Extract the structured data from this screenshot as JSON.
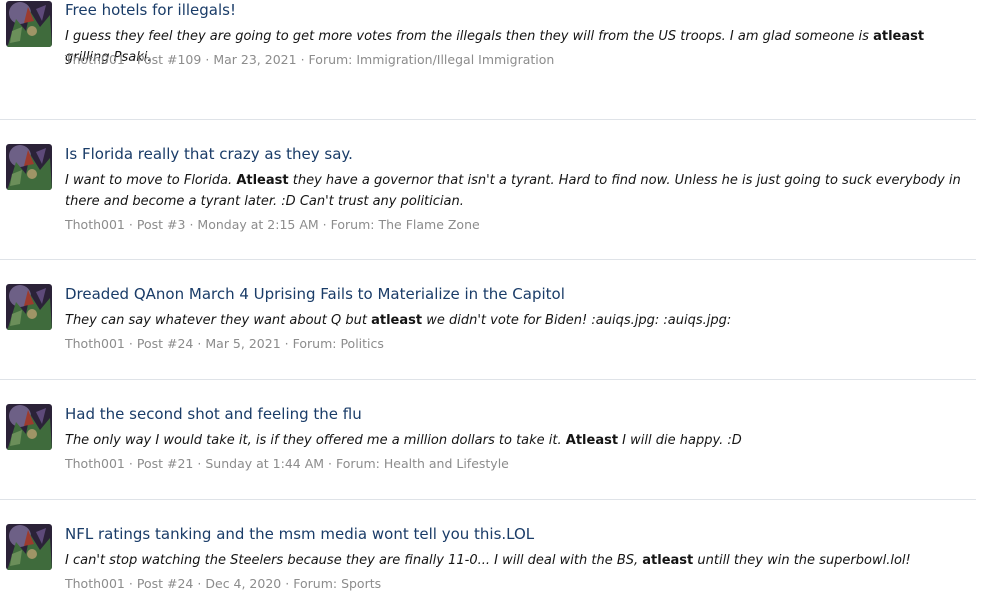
{
  "results": [
    {
      "title": "Free hotels for illegals!",
      "snippet_before": "I guess they feel they are going to get more votes from the illegals then they will from the US troops. I am glad someone is ",
      "highlight": "atleast",
      "snippet_after": " grilling Psaki.",
      "author": "Thoth001",
      "post": "Post #109",
      "date": "Mar 23, 2021",
      "forum_prefix": "Forum:",
      "forum": "Immigration/Illegal Immigration"
    },
    {
      "title": "Is Florida really that crazy as they say.",
      "snippet_before": "I want to move to Florida. ",
      "highlight": "Atleast",
      "snippet_after": " they have a governor that isn't a tyrant. Hard to find now. Unless he is just going to suck everybody in there and become a tyrant later. :D Can't trust any politician.",
      "author": "Thoth001",
      "post": "Post #3",
      "date": "Monday at 2:15 AM",
      "forum_prefix": "Forum:",
      "forum": "The Flame Zone"
    },
    {
      "title": "Dreaded QAnon March 4 Uprising Fails to Materialize in the Capitol",
      "snippet_before": "They can say whatever they want about Q but ",
      "highlight": "atleast",
      "snippet_after": " we didn't vote for Biden! :auiqs.jpg: :auiqs.jpg:",
      "author": "Thoth001",
      "post": "Post #24",
      "date": "Mar 5, 2021",
      "forum_prefix": "Forum:",
      "forum": "Politics"
    },
    {
      "title": "Had the second shot and feeling the flu",
      "snippet_before": "The only way I would take it, is if they offered me a million dollars to take it. ",
      "highlight": "Atleast",
      "snippet_after": " I will die happy. :D",
      "author": "Thoth001",
      "post": "Post #21",
      "date": "Sunday at 1:44 AM",
      "forum_prefix": "Forum:",
      "forum": "Health and Lifestyle"
    },
    {
      "title": "NFL ratings tanking and the msm media wont tell you this.LOL",
      "snippet_before": "I can't stop watching the Steelers because they are finally 11-0... I will deal with the BS, ",
      "highlight": "atleast",
      "snippet_after": " untill they win the superbowl.lol!",
      "author": "Thoth001",
      "post": "Post #24",
      "date": "Dec 4, 2020",
      "forum_prefix": "Forum:",
      "forum": "Sports"
    }
  ],
  "meta_separator": "·",
  "icons": {
    "avatar": "user-avatar-image"
  },
  "colors": {
    "title": "#1a3c68",
    "meta": "#8c8c8c",
    "divider": "#dfe3e8"
  }
}
